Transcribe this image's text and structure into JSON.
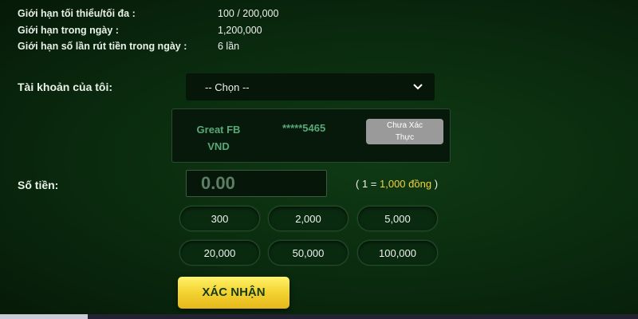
{
  "limits": [
    {
      "label": "Giới hạn tối thiểu/tối đa :",
      "value": "100 / 200,000"
    },
    {
      "label": "Giới hạn trong ngày :",
      "value": "1,200,000"
    },
    {
      "label": "Giới hạn số lần rút tiền trong ngày :",
      "value": "6 lần"
    }
  ],
  "account": {
    "label": "Tài khoản của tôi:",
    "select_value": "-- Chọn --",
    "chevron_icon": "chevron-down-icon"
  },
  "card": {
    "bank_line1": "Great FB",
    "bank_line2": "VND",
    "account_number": "*****5465",
    "status_line1": "Chưa Xác",
    "status_line2": "Thực"
  },
  "amount": {
    "label": "Số tiền:",
    "value": "0.00",
    "rate_prefix": "( 1 = ",
    "rate_highlight": "1,000 đồng",
    "rate_suffix": " )"
  },
  "quick_amounts": [
    "300",
    "2,000",
    "5,000",
    "20,000",
    "50,000",
    "100,000"
  ],
  "confirm_label": "XÁC NHẬN",
  "colors": {
    "background": "#0a2a0e",
    "accent_yellow": "#f4d534",
    "account_text": "#58a878",
    "status_gray": "#9a9a9a"
  }
}
